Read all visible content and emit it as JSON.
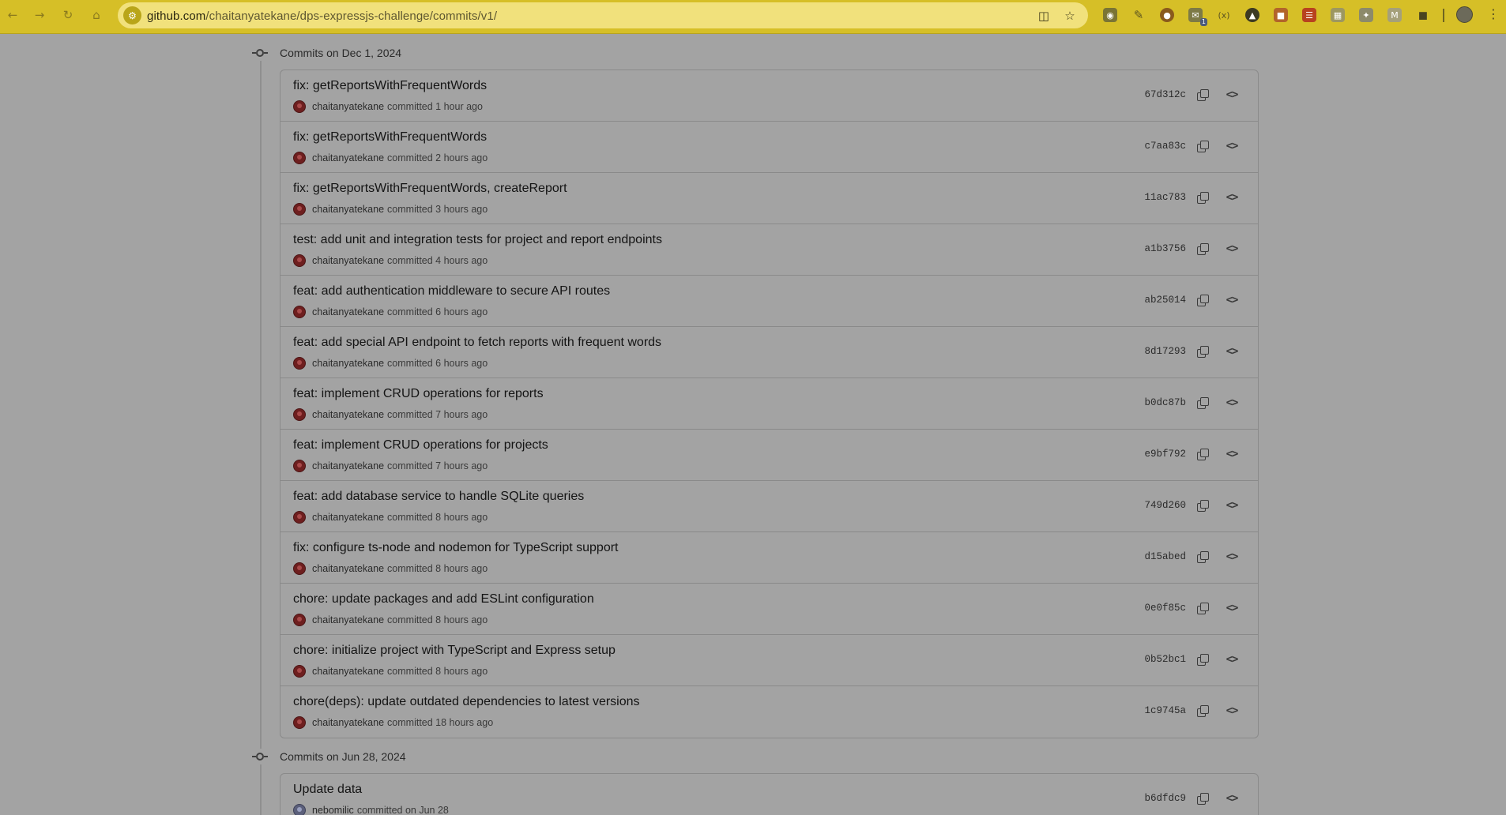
{
  "browser": {
    "url_host": "github.com",
    "url_path": "/chaitanyatekane/dps-expressjs-challenge/commits/v1/",
    "extension_badge": "1",
    "icons": [
      "back-icon",
      "forward-icon",
      "reload-icon",
      "home-icon",
      "site-info-icon",
      "install-app-icon",
      "bookmark-star-icon",
      "camera-extension-icon",
      "pen-extension-icon",
      "cookie-extension-icon",
      "mail-extension-icon",
      "code-extension-icon",
      "shield-extension-icon",
      "color-extension-icon",
      "stripe-extension-icon",
      "grid-extension-icon",
      "bird-extension-icon",
      "m-extension-icon",
      "puzzle-icon",
      "profile-avatar",
      "kebab-menu-icon"
    ],
    "toolbar_color": "#d6bf27"
  },
  "groups": [
    {
      "date_label": "Commits on Dec 1, 2024",
      "commits": [
        {
          "title": "fix: getReportsWithFrequentWords",
          "author": "chaitanyatekane",
          "rest": "committed 1 hour ago",
          "sha": "67d312c"
        },
        {
          "title": "fix: getReportsWithFrequentWords",
          "author": "chaitanyatekane",
          "rest": "committed 2 hours ago",
          "sha": "c7aa83c"
        },
        {
          "title": "fix: getReportsWithFrequentWords, createReport",
          "author": "chaitanyatekane",
          "rest": "committed 3 hours ago",
          "sha": "11ac783"
        },
        {
          "title": "test: add unit and integration tests for project and report endpoints",
          "author": "chaitanyatekane",
          "rest": "committed 4 hours ago",
          "sha": "a1b3756"
        },
        {
          "title": "feat: add authentication middleware to secure API routes",
          "author": "chaitanyatekane",
          "rest": "committed 6 hours ago",
          "sha": "ab25014"
        },
        {
          "title": "feat: add special API endpoint to fetch reports with frequent words",
          "author": "chaitanyatekane",
          "rest": "committed 6 hours ago",
          "sha": "8d17293"
        },
        {
          "title": "feat: implement CRUD operations for reports",
          "author": "chaitanyatekane",
          "rest": "committed 7 hours ago",
          "sha": "b0dc87b"
        },
        {
          "title": "feat: implement CRUD operations for projects",
          "author": "chaitanyatekane",
          "rest": "committed 7 hours ago",
          "sha": "e9bf792"
        },
        {
          "title": "feat: add database service to handle SQLite queries",
          "author": "chaitanyatekane",
          "rest": "committed 8 hours ago",
          "sha": "749d260"
        },
        {
          "title": "fix: configure ts-node and nodemon for TypeScript support",
          "author": "chaitanyatekane",
          "rest": "committed 8 hours ago",
          "sha": "d15abed"
        },
        {
          "title": "chore: update packages and add ESLint configuration",
          "author": "chaitanyatekane",
          "rest": "committed 8 hours ago",
          "sha": "0e0f85c"
        },
        {
          "title": "chore: initialize project with TypeScript and Express setup",
          "author": "chaitanyatekane",
          "rest": "committed 8 hours ago",
          "sha": "0b52bc1"
        },
        {
          "title": "chore(deps): update outdated dependencies to latest versions",
          "author": "chaitanyatekane",
          "rest": "committed 18 hours ago",
          "sha": "1c9745a"
        }
      ]
    },
    {
      "date_label": "Commits on Jun 28, 2024",
      "commits": [
        {
          "title": "Update data",
          "author": "nebomilic",
          "rest": "committed on Jun 28",
          "sha": "b6dfdc9"
        }
      ]
    }
  ]
}
